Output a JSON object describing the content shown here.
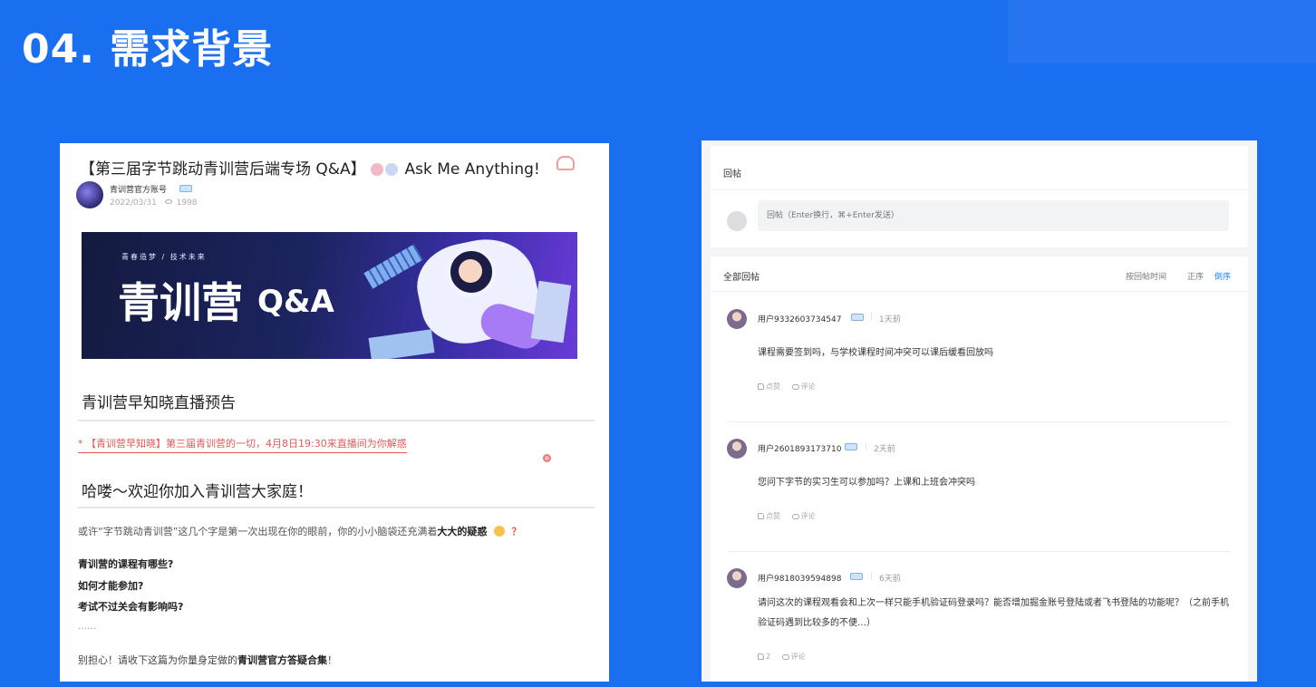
{
  "slide": {
    "title": "04. 需求背景"
  },
  "article": {
    "title": "【第三届字节跳动青训营后端专场 Q&A】",
    "title_suffix": "Ask Me Anything!",
    "author": {
      "name": "青训营官方账号",
      "date": "2022/03/31",
      "views": "1998"
    },
    "banner": {
      "tagline": "青春造梦 / 技术未来",
      "headline": "青训营",
      "headline_suffix": "Q&A"
    },
    "section1": "青训营早知晓直播预告",
    "notice": "* 【青训营早知晓】第三届青训营的一切，4月8日19:30来直播间为你解惑",
    "section2": "哈喽～欢迎你加入青训营大家庭！",
    "intro_prefix": "或许“字节跳动青训营”这几个字是第一次出现在你的眼前，你的小小脑袋还充满着",
    "intro_emphasis": "大大的疑惑",
    "intro_mark": "？",
    "questions": [
      "青训营的课程有哪些?",
      "如何才能参加?",
      "考试不过关会有影响吗?"
    ],
    "ellipsis": "……",
    "closing_prefix": "别担心！请收下这篇为你量身定做的",
    "closing_emphasis": "青训营官方答疑合集",
    "closing_suffix": "！"
  },
  "comments_panel": {
    "reply_label": "回帖",
    "reply_placeholder": "回帖（Enter换行，⌘+Enter发送）",
    "list_title": "全部回帖",
    "sort_label": "按回帖时间",
    "sort_options": [
      "正序",
      "倒序"
    ],
    "sort_active": "倒序",
    "comments": [
      {
        "user": "用户9332603734547",
        "time": "1天前",
        "text": "课程需要签到吗，与学校课程时间冲突可以课后缓看回放吗",
        "likes": "点赞",
        "reply": "评论"
      },
      {
        "user": "用户2601893173710",
        "time": "2天前",
        "text": "您问下字节的实习生可以参加吗？上课和上班会冲突吗",
        "likes": "点赞",
        "reply": "评论"
      },
      {
        "user": "用户9818039594898",
        "time": "6天前",
        "text": "请问这次的课程观看会和上次一样只能手机验证码登录吗？能否增加掘金账号登陆或者飞书登陆的功能呢？（之前手机验证码遇到比较多的不便…）",
        "likes": "2",
        "reply": "评论"
      }
    ]
  },
  "colors": {
    "background": "#1a6ff0",
    "accent": "#1e80ff",
    "notice": "#e05a5a"
  }
}
